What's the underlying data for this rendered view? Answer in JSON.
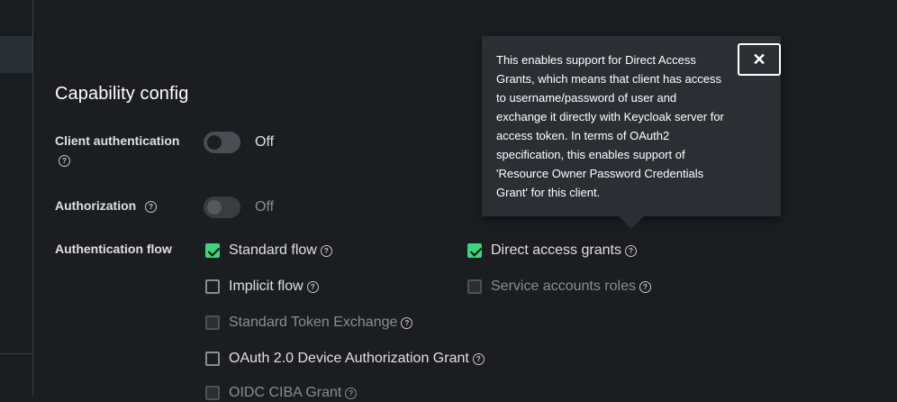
{
  "section": {
    "title": "Capability config"
  },
  "client_auth": {
    "label": "Client authentication",
    "state": "Off"
  },
  "authorization": {
    "label": "Authorization",
    "state": "Off"
  },
  "auth_flow": {
    "label": "Authentication flow",
    "options": {
      "standard_flow": "Standard flow",
      "direct_access": "Direct access grants",
      "implicit_flow": "Implicit flow",
      "service_accounts": "Service accounts roles",
      "token_exchange": "Standard Token Exchange",
      "device_grant": "OAuth 2.0 Device Authorization Grant",
      "ciba": "OIDC CIBA Grant"
    }
  },
  "tooltip": {
    "text": "This enables support for Direct Access Grants, which means that client has access to username/password of user and exchange it directly with Keycloak server for access token. In terms of OAuth2 specification, this enables support of 'Resource Owner Password Credentials Grant' for this client.",
    "close_glyph": "✕"
  },
  "icons": {
    "help": "?"
  },
  "colors": {
    "accent": "#3ed47a",
    "background": "#1b1d21",
    "tooltip_bg": "#2b2f33"
  }
}
